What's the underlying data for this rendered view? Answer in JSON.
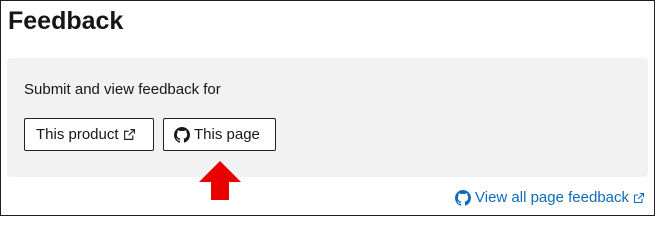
{
  "header": {
    "title": "Feedback"
  },
  "panel": {
    "text": "Submit and view feedback for",
    "buttons": {
      "product_label": "This product",
      "page_label": "This page"
    }
  },
  "footer": {
    "view_all_label": "View all page feedback"
  },
  "icons": {
    "external": "external-link-icon",
    "github": "github-icon",
    "arrow": "red-up-arrow-icon"
  },
  "colors": {
    "panel_bg": "#f2f2f2",
    "link": "#0f6cbd",
    "arrow": "#e80000"
  }
}
